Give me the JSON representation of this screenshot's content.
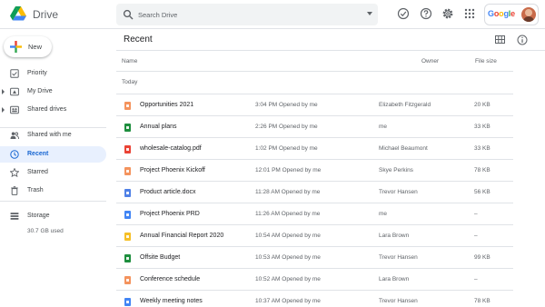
{
  "app": {
    "name": "Drive"
  },
  "search": {
    "placeholder": "Search Drive"
  },
  "account": {
    "brand": "Google"
  },
  "sidebar": {
    "new_label": "New",
    "items": [
      {
        "label": "Priority",
        "icon": "priority-icon"
      },
      {
        "label": "My Drive",
        "icon": "my-drive-icon"
      },
      {
        "label": "Shared drives",
        "icon": "shared-drives-icon"
      },
      {
        "label": "Shared with me",
        "icon": "shared-with-me-icon"
      },
      {
        "label": "Recent",
        "icon": "clock-icon",
        "active": true
      },
      {
        "label": "Starred",
        "icon": "star-icon"
      },
      {
        "label": "Trash",
        "icon": "trash-icon"
      },
      {
        "label": "Storage",
        "icon": "storage-icon"
      }
    ],
    "storage_used": "30.7 GB used"
  },
  "main": {
    "title": "Recent",
    "columns": {
      "name": "Name",
      "owner": "Owner",
      "size": "File size"
    },
    "section": "Today",
    "rows": [
      {
        "name": "Opportunities 2021",
        "opened": "3:04 PM Opened by me",
        "owner": "Elizabeth Fitzgerald",
        "size": "20 KB",
        "type": "slides"
      },
      {
        "name": "Annual plans",
        "opened": "2:26 PM Opened by me",
        "owner": "me",
        "size": "33 KB",
        "type": "sheets"
      },
      {
        "name": "wholesale-catalog.pdf",
        "opened": "1:02 PM Opened by me",
        "owner": "Michael Beaumont",
        "size": "33 KB",
        "type": "pdf"
      },
      {
        "name": "Project Phoenix Kickoff",
        "opened": "12:01 PM Opened by me",
        "owner": "Skye Perkins",
        "size": "78 KB",
        "type": "slides"
      },
      {
        "name": "Product article.docx",
        "opened": "11:28 AM Opened by me",
        "owner": "Trevor Hansen",
        "size": "56 KB",
        "type": "word"
      },
      {
        "name": "Project Phoenix PRD",
        "opened": "11:26 AM Opened by me",
        "owner": "me",
        "size": "–",
        "type": "docs"
      },
      {
        "name": "Annual Financial Report 2020",
        "opened": "10:54 AM Opened by me",
        "owner": "Lara Brown",
        "size": "–",
        "type": "slides-yellow"
      },
      {
        "name": "Offsite Budget",
        "opened": "10:53 AM Opened by me",
        "owner": "Trevor Hansen",
        "size": "99 KB",
        "type": "sheets"
      },
      {
        "name": "Conference schedule",
        "opened": "10:52 AM Opened by me",
        "owner": "Lara Brown",
        "size": "–",
        "type": "slides"
      },
      {
        "name": "Weekly meeting notes",
        "opened": "10:37 AM Opened by me",
        "owner": "Trevor Hansen",
        "size": "78 KB",
        "type": "docs"
      }
    ]
  },
  "colors": {
    "accent": "#1a73e8",
    "active_bg": "#e8f0fe",
    "active_text": "#1967d2",
    "slides": "#f4935d",
    "slides-yellow": "#f6bf26",
    "sheets": "#1e8e3e",
    "pdf": "#ea4335",
    "word": "#4f80e6",
    "docs": "#4285f4"
  }
}
